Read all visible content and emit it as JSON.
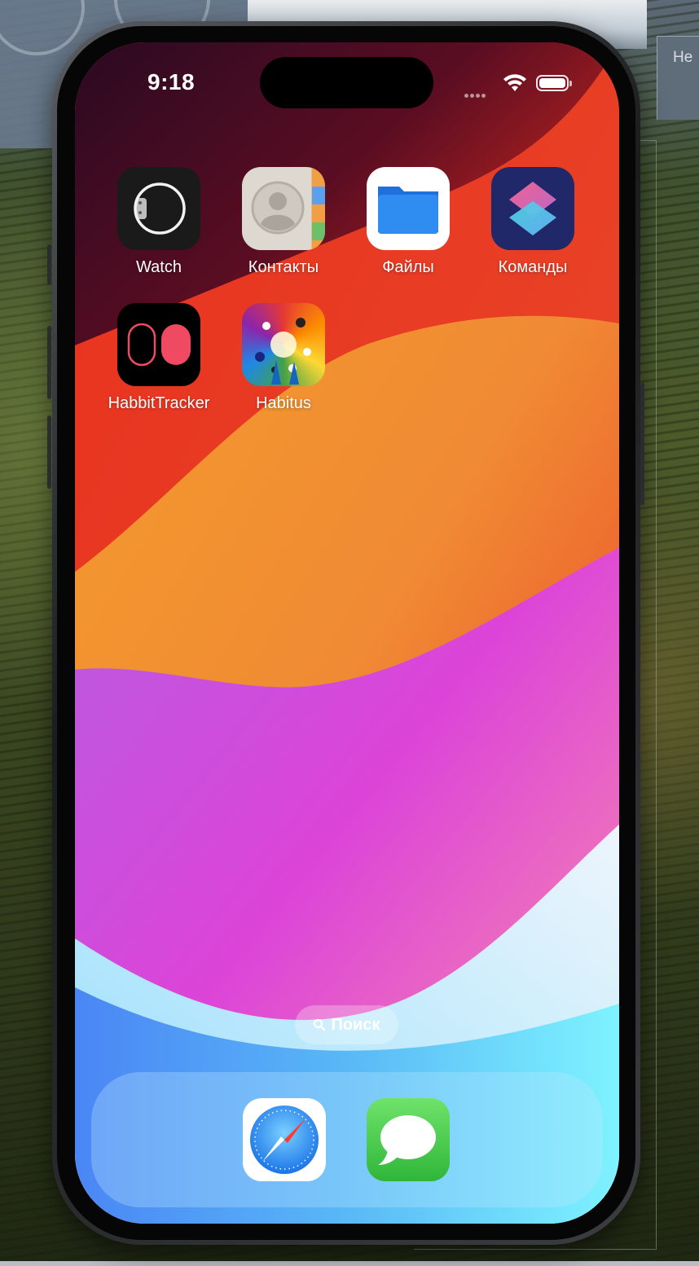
{
  "mac_desktop": {
    "right_panel_text": "Не"
  },
  "status_bar": {
    "time": "9:18",
    "icons": [
      "cellular-dots-icon",
      "wifi-icon",
      "battery-icon"
    ],
    "battery_level": 1.0
  },
  "home_screen": {
    "apps": [
      {
        "label": "Watch",
        "icon": "watch-icon"
      },
      {
        "label": "Контакты",
        "icon": "contacts-icon"
      },
      {
        "label": "Файлы",
        "icon": "folder-icon"
      },
      {
        "label": "Команды",
        "icon": "shortcuts-icon"
      },
      {
        "label": "HabbitTracker",
        "icon": "habbittracker-icon"
      },
      {
        "label": "Habitus",
        "icon": "habitus-icon"
      }
    ],
    "search": {
      "label": "Поиск",
      "icon": "search-icon"
    }
  },
  "dock": {
    "apps": [
      {
        "icon": "safari-compass-icon"
      },
      {
        "icon": "messages-bubble-icon"
      }
    ]
  },
  "colors": {
    "wallpaper_dark": "#3a0d24",
    "wallpaper_red": "#e23a26",
    "wallpaper_orange": "#f0a030",
    "wallpaper_magenta": "#d944d6",
    "wallpaper_cyan": "#7ef3ff",
    "habbit_accent": "#ef4a62",
    "files_blue": "#2f8cf0"
  }
}
